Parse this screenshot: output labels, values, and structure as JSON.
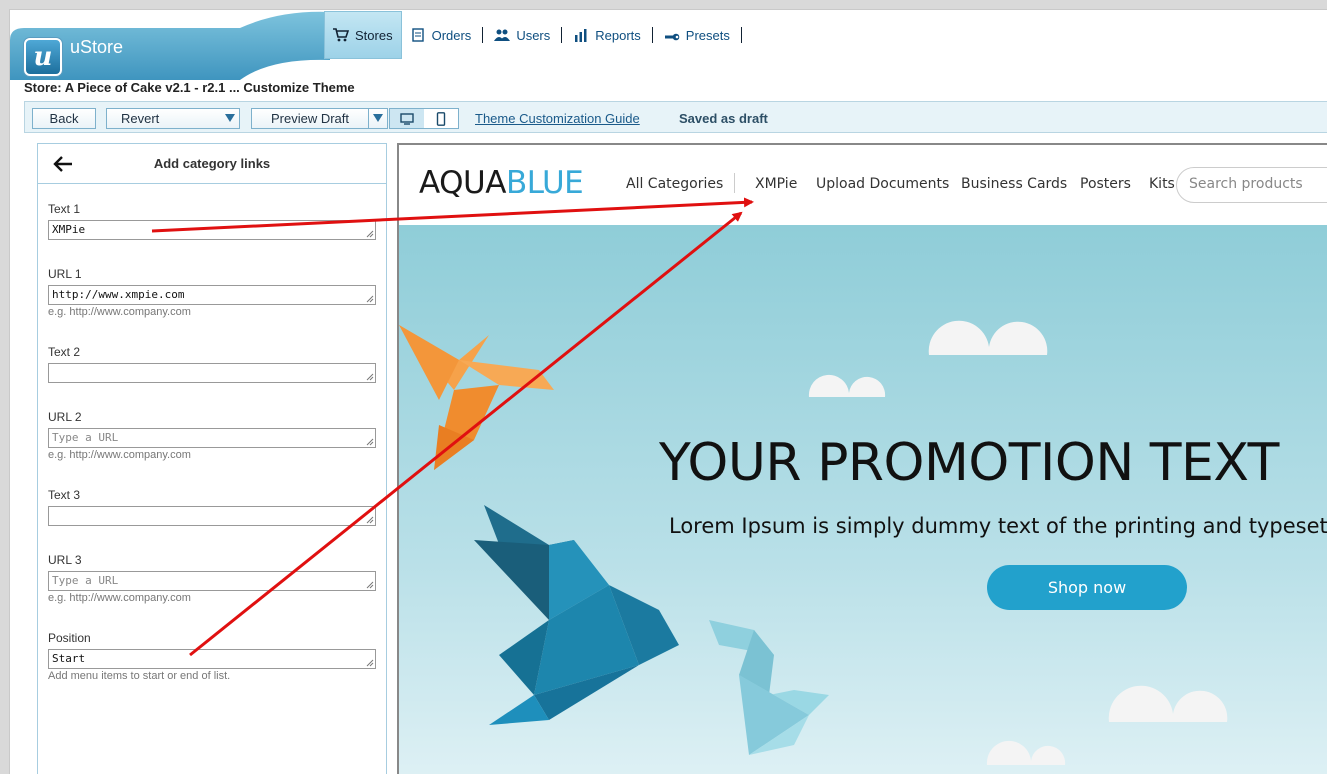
{
  "app": {
    "name": "uStore",
    "logo_letter": "u"
  },
  "nav": [
    {
      "label": "Stores",
      "icon": "cart-icon",
      "active": true
    },
    {
      "label": "Orders",
      "icon": "orders-icon"
    },
    {
      "label": "Users",
      "icon": "users-icon"
    },
    {
      "label": "Reports",
      "icon": "reports-icon"
    },
    {
      "label": "Presets",
      "icon": "wrench-icon"
    }
  ],
  "store_title": "Store: A Piece of Cake v2.1 - r2.1 ... Customize Theme",
  "toolbar": {
    "back_label": "Back",
    "revert_label": "Revert",
    "preview_label": "Preview Draft",
    "guide_link": "Theme Customization Guide",
    "status": "Saved as draft",
    "device_selected": "desktop"
  },
  "panel": {
    "title": "Add category links",
    "fields": [
      {
        "label": "Text 1",
        "value": "XMPie",
        "placeholder": "",
        "hint": ""
      },
      {
        "label": "URL 1",
        "value": "http://www.xmpie.com",
        "placeholder": "",
        "hint": "e.g. http://www.company.com"
      },
      {
        "label": "Text 2",
        "value": "",
        "placeholder": "",
        "hint": ""
      },
      {
        "label": "URL 2",
        "value": "",
        "placeholder": "Type a URL",
        "hint": "e.g. http://www.company.com"
      },
      {
        "label": "Text 3",
        "value": "",
        "placeholder": "",
        "hint": ""
      },
      {
        "label": "URL 3",
        "value": "",
        "placeholder": "Type a URL",
        "hint": "e.g. http://www.company.com"
      },
      {
        "label": "Position",
        "value": "Start",
        "placeholder": "",
        "hint": "Add menu items to start or end of list."
      }
    ]
  },
  "preview": {
    "brand_part1": "AQUA",
    "brand_part2": "BLUE",
    "nav": [
      "All Categories",
      "XMPie",
      "Upload Documents",
      "Business Cards",
      "Posters",
      "Kits"
    ],
    "search_placeholder": "Search products",
    "hero_title": "YOUR PROMOTION TEXT",
    "hero_subtitle": "Lorem Ipsum is simply dummy text of the printing and typesetting",
    "cta": "Shop now"
  },
  "colors": {
    "accent": "#38a9d8",
    "cta": "#22a1cc",
    "annotation_arrow": "#e01010"
  }
}
